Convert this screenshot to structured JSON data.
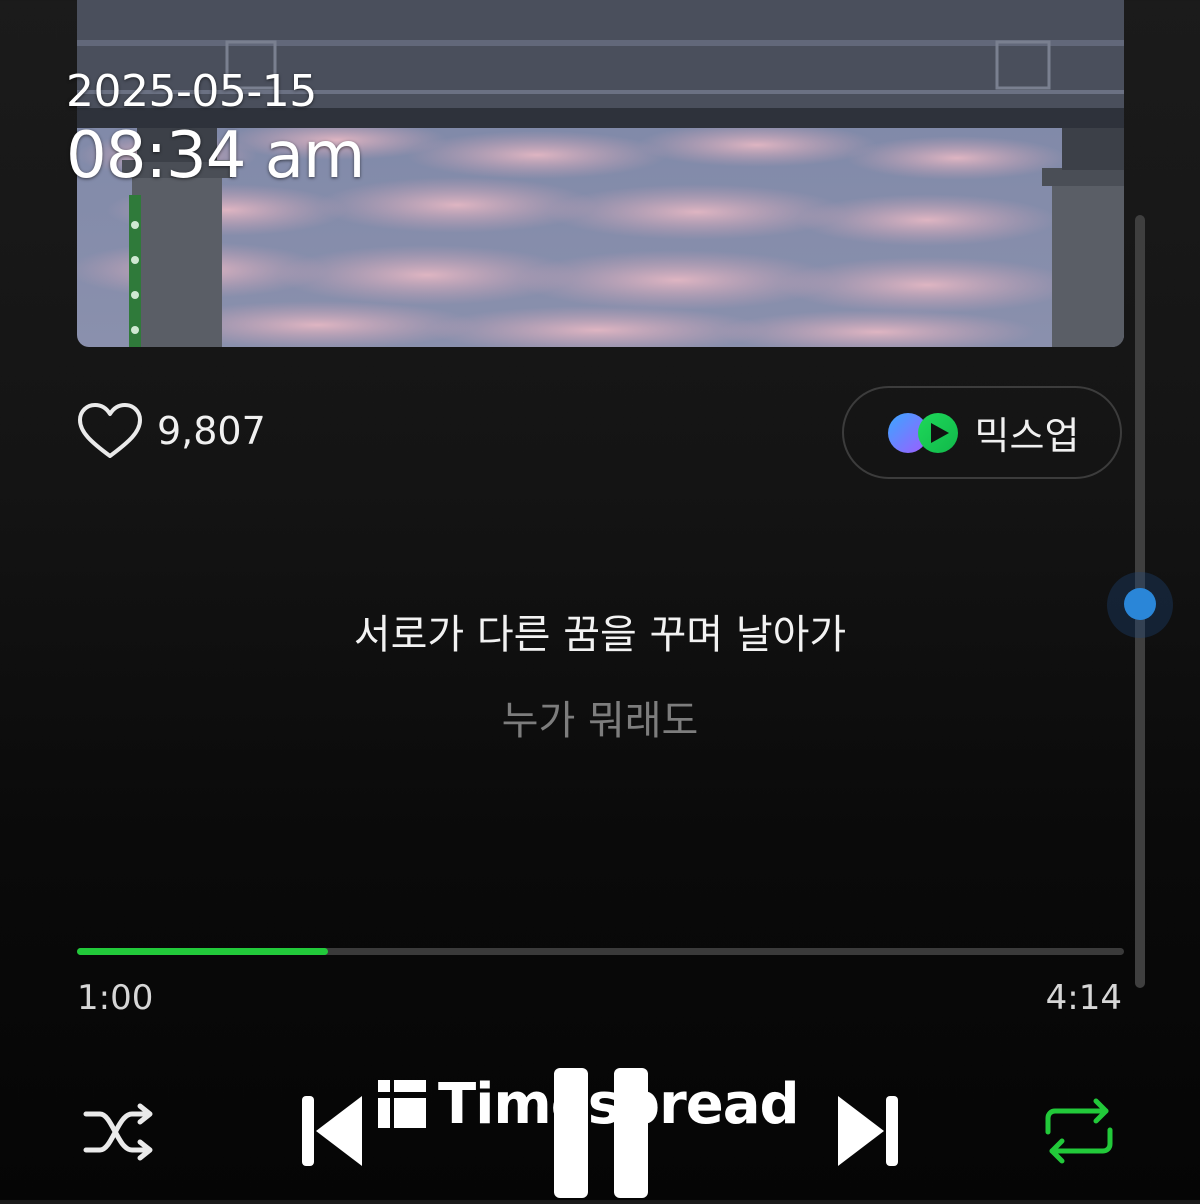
{
  "overlay": {
    "date": "2025-05-15",
    "time": "08:34 am"
  },
  "album": {
    "icon": "album-art-image"
  },
  "like": {
    "icon": "heart-icon",
    "count": "9,807"
  },
  "mixup": {
    "icon": "mixup-logo-icon",
    "label": "믹스업"
  },
  "lyrics": {
    "current": "서로가 다른 꿈을 꾸며 날아가",
    "next": "누가 뭐래도"
  },
  "progress": {
    "current_time": "1:00",
    "total_time": "4:14",
    "fraction": 0.24
  },
  "controls": {
    "shuffle_icon": "shuffle-icon",
    "prev_icon": "skip-previous-icon",
    "play_pause_icon": "pause-icon",
    "next_icon": "skip-next-icon",
    "repeat_icon": "repeat-icon",
    "repeat_active": true
  },
  "watermark": {
    "text": "Timespread"
  },
  "colors": {
    "accent": "#22c93a",
    "scroll_thumb": "#2a86d8"
  }
}
